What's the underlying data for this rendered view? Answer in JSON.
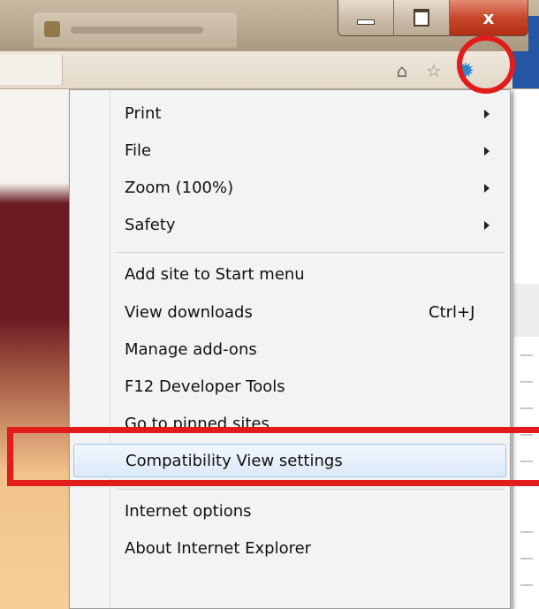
{
  "window": {
    "controls": {
      "minimize_icon": "minimize-icon",
      "maximize_icon": "restore-icon",
      "close_label": "x"
    }
  },
  "toolbar": {
    "icons": [
      "home-icon",
      "star-icon",
      "gear-icon"
    ],
    "home_glyph": "⌂",
    "star_glyph": "☆",
    "gear_glyph": "✹"
  },
  "menu": {
    "items": [
      {
        "label": "Print",
        "submenu": true
      },
      {
        "label": "File",
        "submenu": true
      },
      {
        "label": "Zoom (100%)",
        "submenu": true
      },
      {
        "label": "Safety",
        "submenu": true
      },
      {
        "label": "Add site to Start menu"
      },
      {
        "label": "View downloads",
        "accelerator": "Ctrl+J"
      },
      {
        "label": "Manage add-ons"
      },
      {
        "label": "F12 Developer Tools"
      },
      {
        "label": "Go to pinned sites"
      },
      {
        "label": "Compatibility View settings",
        "highlighted": true
      },
      {
        "label": "Internet options"
      },
      {
        "label": "About Internet Explorer"
      }
    ]
  },
  "colors": {
    "annotation_red": "#e21b1b",
    "gear_blue": "#2c86c9",
    "highlight_border": "#a7c4e6"
  }
}
